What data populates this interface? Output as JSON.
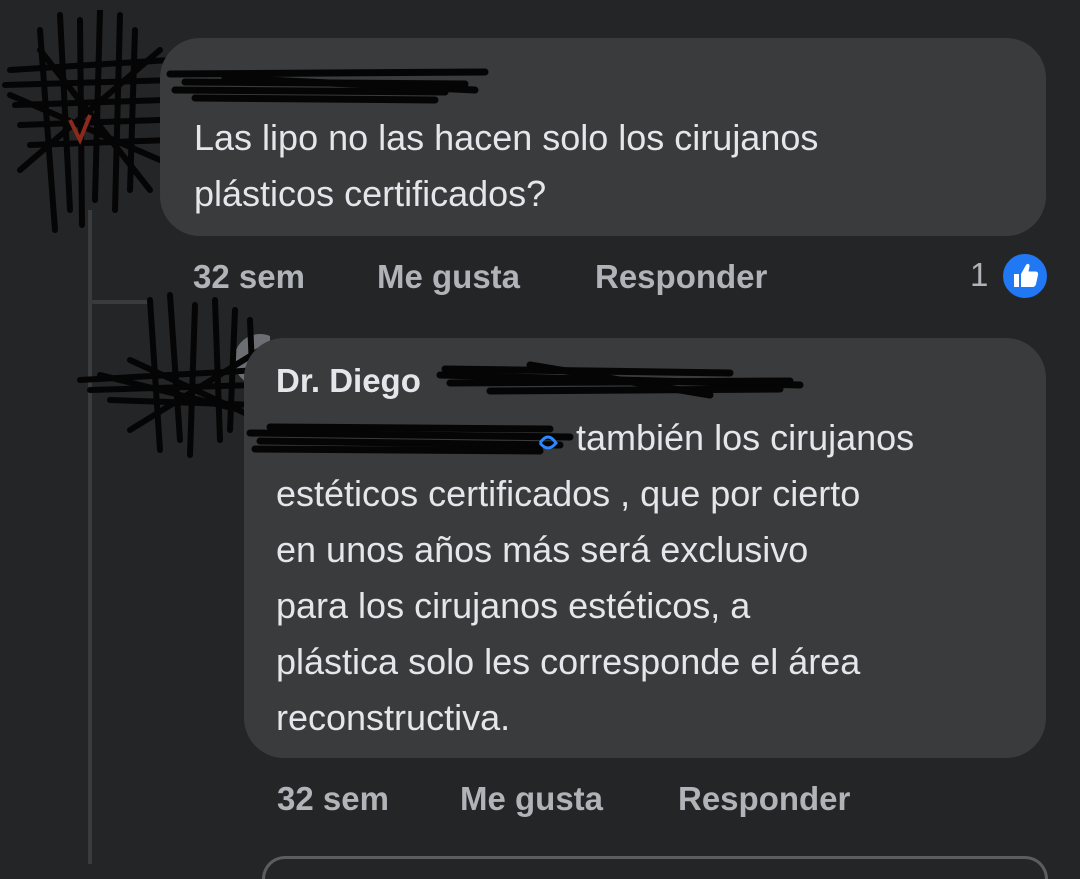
{
  "comment1": {
    "text": "Las lipo no las hacen solo los cirujanos\nplásticos certificados?",
    "time": "32 sem",
    "like_label": "Me gusta",
    "reply_label": "Responder",
    "reaction_count": "1",
    "reaction_icon": "thumbs-up-icon"
  },
  "comment2": {
    "author": "Dr. Diego",
    "text": "también los cirujanos\nestéticos certificados , que por cierto\nen unos años más será exclusivo\npara los cirujanos estéticos,  a\nplástica solo les corresponde el área\nreconstructiva.",
    "time": "32 sem",
    "like_label": "Me gusta",
    "reply_label": "Responder"
  },
  "colors": {
    "background": "#242526",
    "bubble": "#3a3b3c",
    "text": "#e4e6eb",
    "meta": "#b0b3b8",
    "like_blue": "#2078f4"
  }
}
